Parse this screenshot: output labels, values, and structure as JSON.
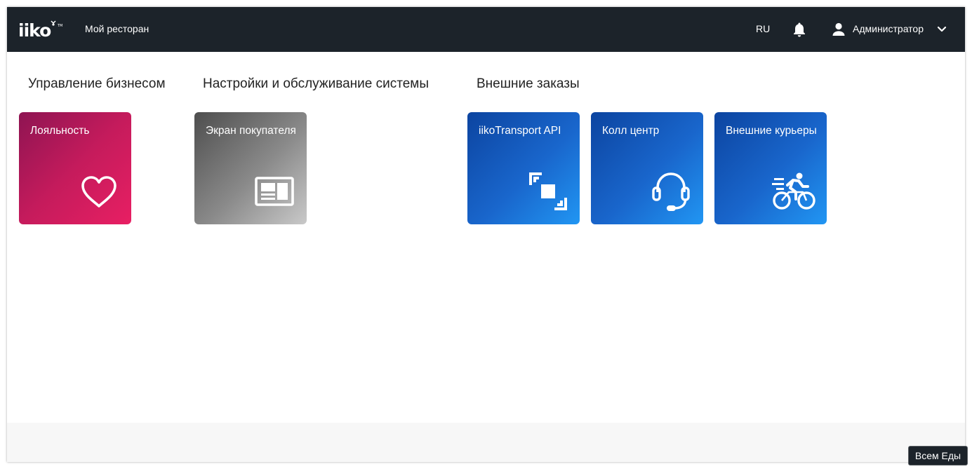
{
  "header": {
    "logo_text": "iiko",
    "restaurant": "Мой ресторан",
    "language": "RU",
    "user_name": "Администратор"
  },
  "sections": [
    {
      "title": "Управление бизнесом",
      "tiles": [
        {
          "label": "Лояльность",
          "icon": "heart-icon"
        }
      ]
    },
    {
      "title": "Настройки и обслуживание системы",
      "tiles": [
        {
          "label": "Экран покупателя",
          "icon": "customer-display-icon"
        }
      ]
    },
    {
      "title": "Внешние заказы",
      "tiles": [
        {
          "label": "iikoTransport API",
          "icon": "transport-api-icon"
        },
        {
          "label": "Колл центр",
          "icon": "headset-icon"
        },
        {
          "label": "Внешние курьеры",
          "icon": "bicycle-courier-icon"
        }
      ]
    }
  ],
  "colors": {
    "topbar": "#1c232a",
    "loyalty_tile": "#c51b5c",
    "settings_tile": "#8a8a8a",
    "orders_tile": "#1966cc"
  },
  "toast": {
    "text": "Всем Еды"
  }
}
